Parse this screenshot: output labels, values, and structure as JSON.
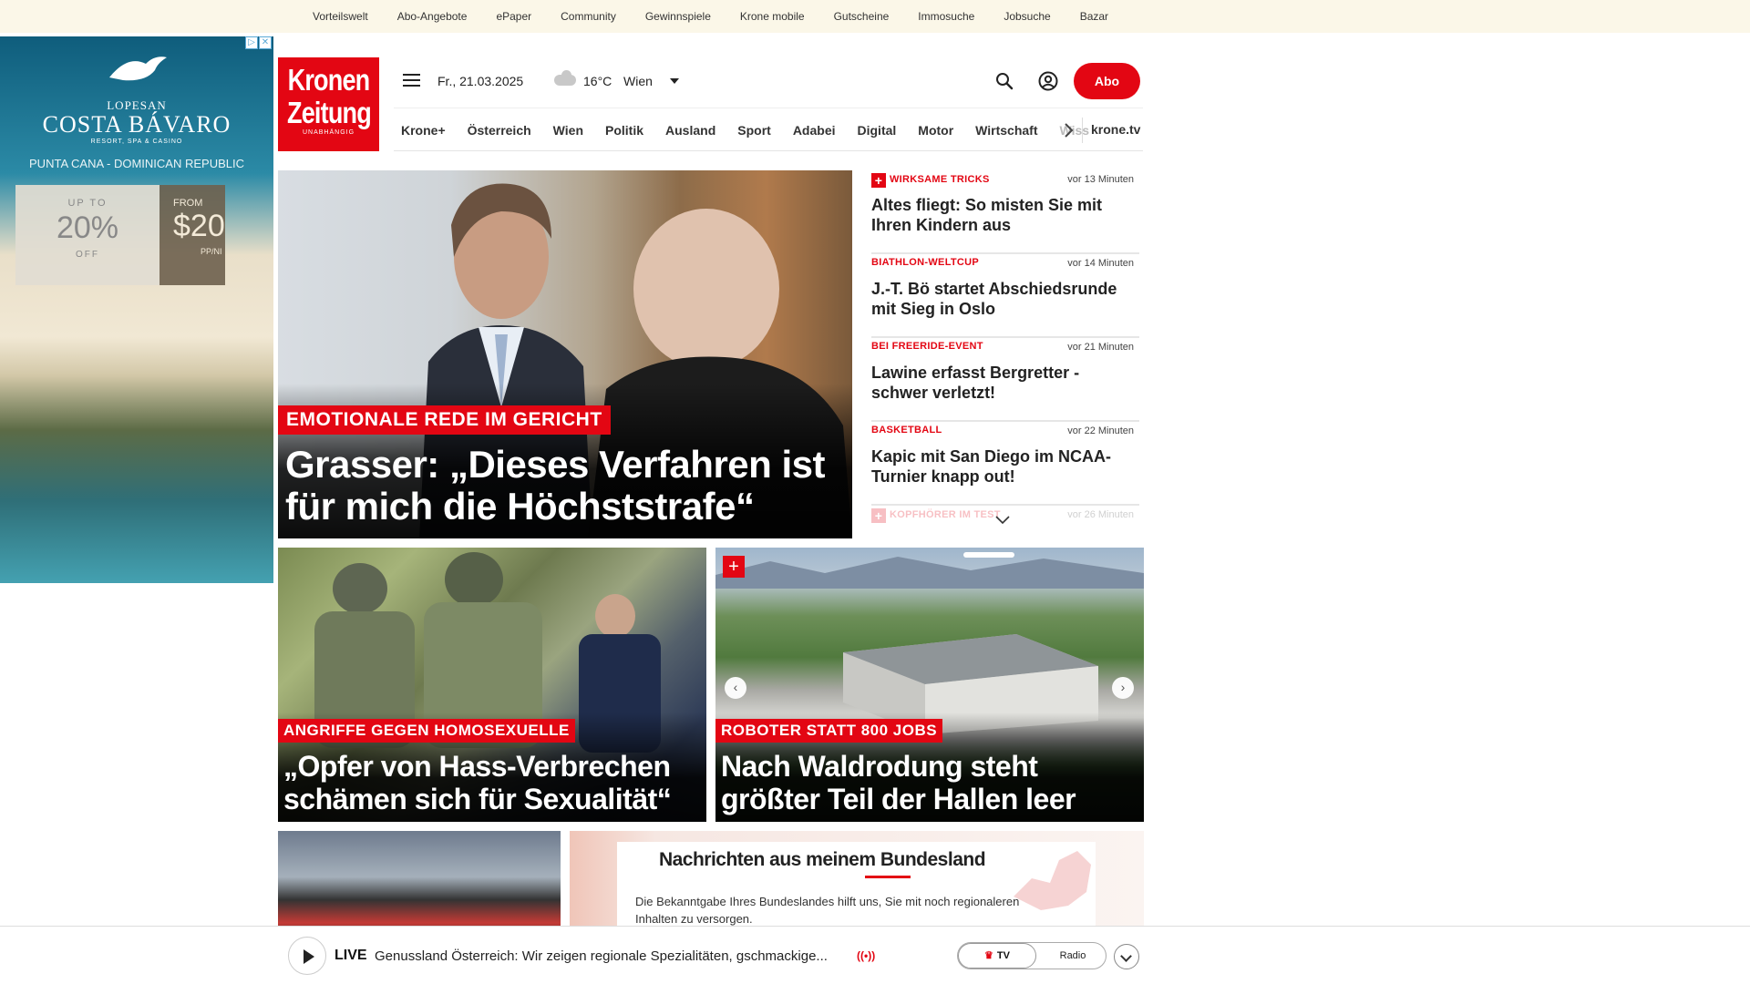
{
  "topbar": {
    "links": [
      "Vorteilswelt",
      "Abo-Angebote",
      "ePaper",
      "Community",
      "Gewinnspiele",
      "Krone mobile",
      "Gutscheine",
      "Immosuche",
      "Jobsuche",
      "Bazar"
    ]
  },
  "ad": {
    "brand_top": "LOPESAN",
    "brand": "COSTA BÁVARO",
    "brand_sub": "RESORT, SPA & CASINO",
    "location": "PUNTA CANA - DOMINICAN REPUBLIC",
    "box1": {
      "small": "UP TO",
      "big": "20%",
      "small2": "OFF"
    },
    "box2": {
      "small": "FROM",
      "big": "$20",
      "small2": "PP/NI"
    }
  },
  "header": {
    "logo": {
      "line1": "Kronen",
      "line2": "Zeitung",
      "line3": "UNABHÄNGIG"
    },
    "date": "Fr., 21.03.2025",
    "temperature": "16°C",
    "city": "Wien",
    "abo_label": "Abo"
  },
  "nav": {
    "items": [
      "Krone+",
      "Österreich",
      "Wien",
      "Politik",
      "Ausland",
      "Sport",
      "Adabei",
      "Digital",
      "Motor",
      "Wirtschaft",
      "Wiss"
    ],
    "tv_label": "krone.tv"
  },
  "hero": {
    "kicker": "EMOTIONALE REDE IM GERICHT",
    "headline": "Grasser: „Dieses Verfahren ist für mich die Höchststrafe“"
  },
  "ticker": [
    {
      "category": "WIRKSAME TRICKS",
      "plus": true,
      "time": "vor 13 Minuten",
      "title": "Altes fliegt: So misten Sie mit Ihren Kindern aus"
    },
    {
      "category": "BIATHLON-WELTCUP",
      "plus": false,
      "time": "vor 14 Minuten",
      "title": "J.-T. Bö startet Abschiedsrunde mit Sieg in Oslo"
    },
    {
      "category": "BEI FREERIDE-EVENT",
      "plus": false,
      "time": "vor 21 Minuten",
      "title": "Lawine erfasst Bergretter - schwer verletzt!"
    },
    {
      "category": "BASKETBALL",
      "plus": false,
      "time": "vor 22 Minuten",
      "title": "Kapic mit San Diego im NCAA-Turnier knapp out!"
    },
    {
      "category": "KOPFHÖRER IM TEST",
      "plus": true,
      "time": "vor 26 Minuten",
      "title": ""
    }
  ],
  "cards": {
    "card1": {
      "kicker": "ANGRIFFE GEGEN HOMOSEXUELLE",
      "headline": "„Opfer von Hass-Verbrechen schämen sich für Sexualität“"
    },
    "card2": {
      "kicker": "ROBOTER STATT 800 JOBS",
      "headline": "Nach Waldrodung steht größter Teil der Hallen leer"
    }
  },
  "bundesland": {
    "title": "Nachrichten aus meinem Bundesland",
    "desc": "Die Bekanntgabe Ihres Bundeslandes hilft uns, Sie mit noch regionaleren Inhalten zu versorgen."
  },
  "player": {
    "live_label": "LIVE",
    "text": "Genussland Österreich: Wir zeigen regionale Spezialitäten, gschmackige...",
    "tv_label": "TV",
    "radio_label": "Radio"
  },
  "colors": {
    "brand_red": "#e30613",
    "topbar_bg": "#fbf7e8"
  }
}
